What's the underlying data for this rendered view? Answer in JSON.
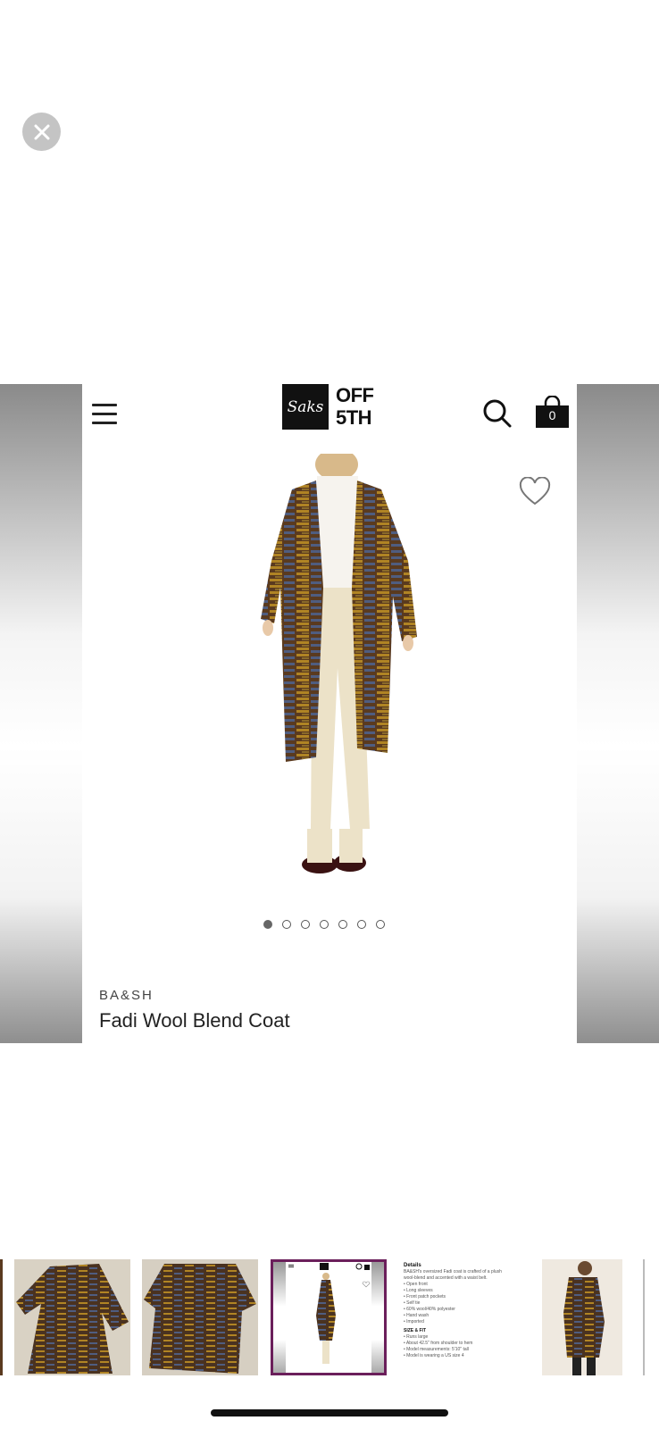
{
  "viewer": {
    "close_icon": "close-icon",
    "image_count": 7,
    "active_image": 1
  },
  "screenshot": {
    "header": {
      "menu_icon": "hamburger-menu-icon",
      "logo_script": "Saks",
      "logo_line1": "OFF",
      "logo_line2": "5TH",
      "search_icon": "search-icon",
      "bag_icon": "shopping-bag-icon",
      "bag_count": "0"
    },
    "favorite_icon": "heart-icon",
    "brand": "BA&SH",
    "product_name": "Fadi Wool Blend Coat"
  },
  "thumbnails": {
    "selected_index": 3,
    "accent_color": "#6b1f5b",
    "detail_thumb": {
      "heading": "Details",
      "description": "BA&SH's oversized Fadi coat is crafted of a plush wool-blend and accented with a waist belt.",
      "bullets": [
        "Open front",
        "Long sleeves",
        "Front patch pockets",
        "Self tie",
        "60% wool/40% polyester",
        "Hand wash",
        "Imported"
      ],
      "size_heading": "SIZE & FIT",
      "size_bullets": [
        "Runs large",
        "About 42.5\" from shoulder to hem",
        "Model measurements: 5'10\" tall",
        "Model is wearing a US size 4"
      ]
    }
  },
  "colors": {
    "coat_brown": "#5a3a1f",
    "coat_gold": "#b08424",
    "coat_blue": "#4f5d80",
    "pants_cream": "#ece2c8"
  }
}
